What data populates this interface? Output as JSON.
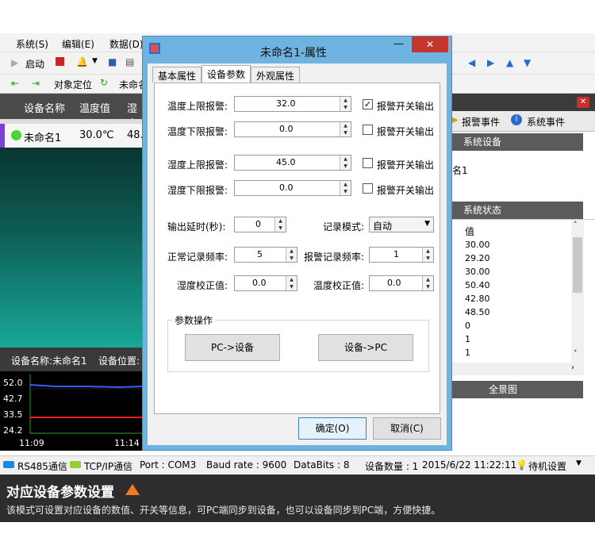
{
  "menu": {
    "system": "系统(S)",
    "edit": "编辑(E)",
    "data": "数据(D)"
  },
  "toolbar": {
    "start": "启动",
    "locate": "对象定位",
    "current_obj": "未命名"
  },
  "grid": {
    "col_name": "设备名称",
    "col_temp": "温度值",
    "col_hum": "湿度",
    "row_name": "未命名1",
    "row_temp": "30.0℃",
    "row_hum": "48."
  },
  "device_bar": {
    "name": "设备名称:未命名1",
    "location": "设备位置:"
  },
  "chart_left": {
    "ticks": [
      "52.0",
      "42.7",
      "33.5",
      "24.2"
    ],
    "times": [
      "11:09",
      "11:14"
    ]
  },
  "right": {
    "tab_alarm": "报警事件",
    "tab_system": "系统事件",
    "sec_devices": "系统设备",
    "device_item": "名1",
    "sec_status": "系统状态",
    "col_value": "值",
    "values": [
      "30.00",
      "29.20",
      "30.00",
      "50.40",
      "42.80",
      "48.50",
      "0",
      "1",
      "1"
    ],
    "sec_panorama": "全景图"
  },
  "dialog": {
    "title": "未命名1-属性",
    "tabs": [
      "基本属性",
      "设备参数",
      "外观属性"
    ],
    "temp_upper_label": "温度上限报警:",
    "temp_upper_value": "32.0",
    "temp_lower_label": "温度下限报警:",
    "temp_lower_value": "0.0",
    "hum_upper_label": "湿度上限报警:",
    "hum_upper_value": "45.0",
    "hum_lower_label": "湿度下限报警:",
    "hum_lower_value": "0.0",
    "alarm_output": "报警开关输出",
    "delay_label": "输出延时(秒):",
    "delay_value": "0",
    "record_mode_label": "记录模式:",
    "record_mode_value": "自动",
    "normal_freq_label": "正常记录频率:",
    "normal_freq_value": "5",
    "alarm_freq_label": "报警记录频率:",
    "alarm_freq_value": "1",
    "hum_cal_label": "湿度校正值:",
    "hum_cal_value": "0.0",
    "temp_cal_label": "温度校正值:",
    "temp_cal_value": "0.0",
    "group_label": "参数操作",
    "pc_to_dev": "PC->设备",
    "dev_to_pc": "设备->PC",
    "ok": "确定(O)",
    "cancel": "取消(C)"
  },
  "status": {
    "rs485": "RS485通信",
    "tcp": "TCP/IP通信",
    "port": "Port : COM3",
    "baud": "Baud rate : 9600",
    "databits": "DataBits : 8",
    "count": "设备数量 : 1",
    "datetime": "2015/6/22 11:22:11",
    "standby": "待机设置"
  },
  "caption": {
    "title": "对应设备参数设置",
    "desc": "该模式可设置对应设备的数值、开关等信息，可PC端同步到设备，也可以设备同步到PC端，方便快捷。"
  }
}
